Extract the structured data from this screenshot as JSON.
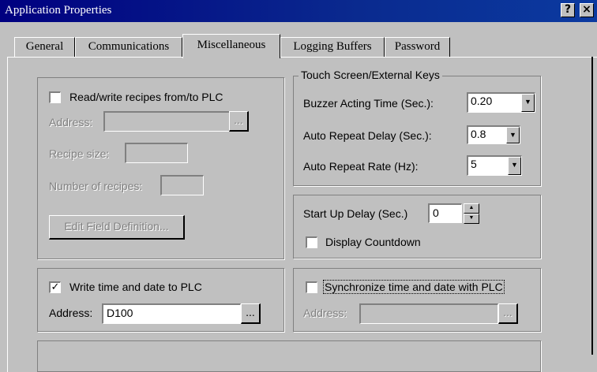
{
  "window": {
    "title": "Application Properties",
    "help_button": "?",
    "close_button": "×"
  },
  "tabs": [
    {
      "label": "General"
    },
    {
      "label": "Communications"
    },
    {
      "label": "Miscellaneous"
    },
    {
      "label": "Logging Buffers"
    },
    {
      "label": "Password"
    }
  ],
  "active_tab": "Miscellaneous",
  "recipes": {
    "checkbox_label": "Read/write recipes from/to PLC",
    "checked": false,
    "address_label": "Address:",
    "address_value": "",
    "browse_label": "...",
    "recipe_size_label": "Recipe size:",
    "recipe_size_value": "",
    "num_recipes_label": "Number of recipes:",
    "num_recipes_value": "",
    "edit_button": "Edit Field Definition..."
  },
  "touch": {
    "title": "Touch Screen/External Keys",
    "buzzer_label": "Buzzer Acting Time (Sec.):",
    "buzzer_value": "0.20",
    "repeat_delay_label": "Auto Repeat Delay (Sec.):",
    "repeat_delay_value": "0.8",
    "repeat_rate_label": "Auto Repeat Rate (Hz):",
    "repeat_rate_value": "5"
  },
  "startup": {
    "delay_label": "Start Up Delay (Sec.)",
    "delay_value": "0",
    "countdown_label": "Display Countdown",
    "countdown_checked": false
  },
  "write_time": {
    "checkbox_label": "Write time and date to PLC",
    "checked": true,
    "address_label": "Address:",
    "address_value": "D100",
    "browse_label": "..."
  },
  "sync_time": {
    "checkbox_label": "Synchronize time and date with PLC",
    "checked": false,
    "address_label": "Address:",
    "address_value": "",
    "browse_label": "..."
  },
  "colors": {
    "face": "#c0c0c0",
    "title_bar": "#000080",
    "disabled_text": "#808080"
  }
}
